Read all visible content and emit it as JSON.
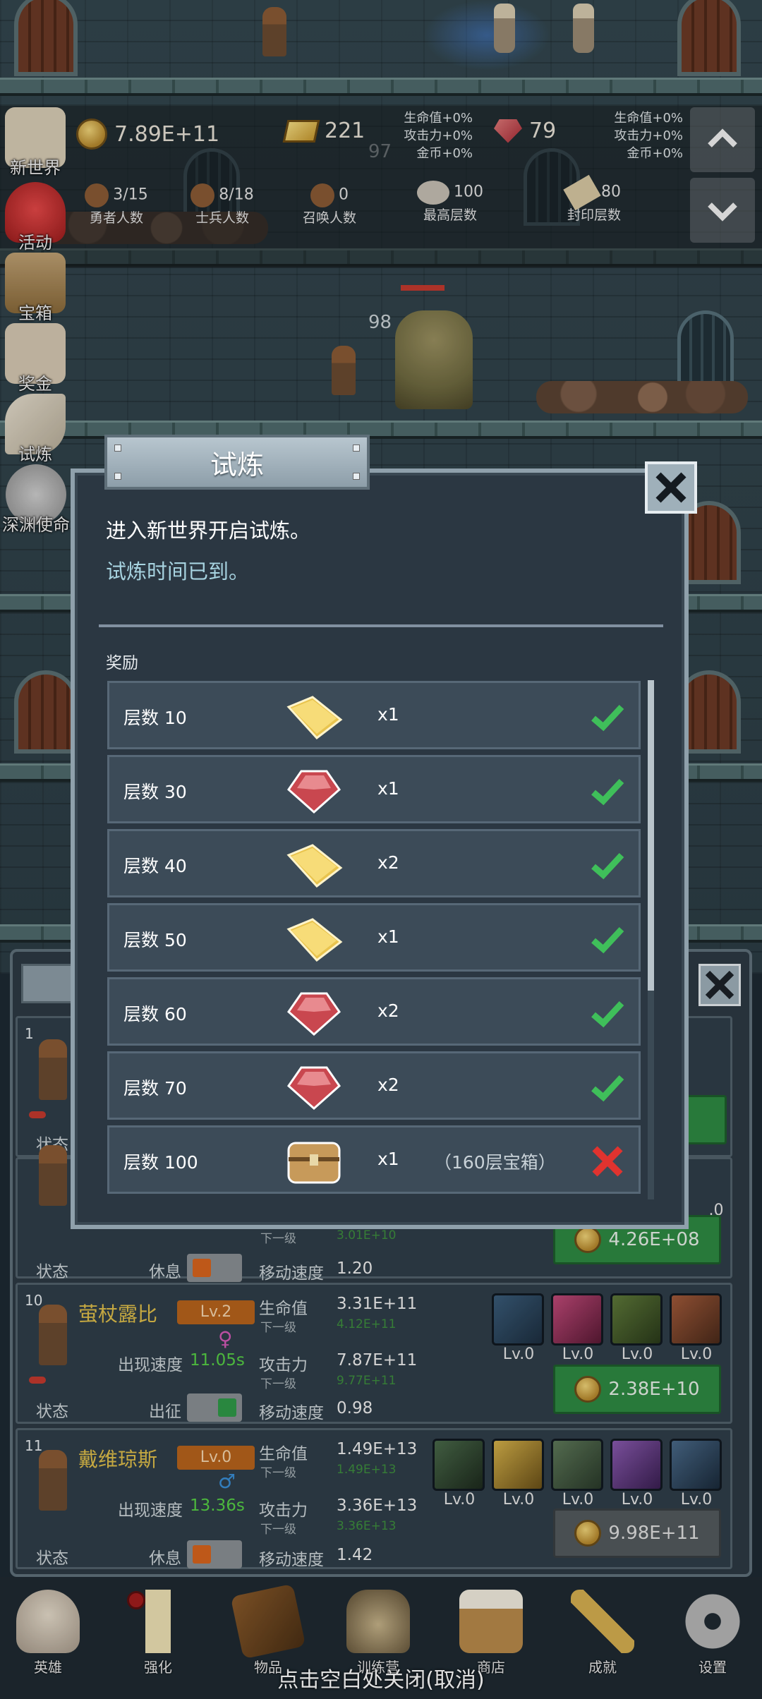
{
  "hud": {
    "gold": "7.89E+11",
    "goldbars": "221",
    "rubies": "79",
    "bonus_left": [
      "生命值+0%",
      "攻击力+0%",
      "金币+0%"
    ],
    "bonus_right": [
      "生命值+0%",
      "攻击力+0%",
      "金币+0%"
    ],
    "hero_count": "3/15",
    "hero_count_label": "勇者人数",
    "soldier_count": "8/18",
    "soldier_count_label": "士兵人数",
    "summon_count": "0",
    "summon_count_label": "召唤人数",
    "max_floor": "100",
    "max_floor_label": "最高层数",
    "sealed_floor": "80",
    "sealed_floor_label": "封印层数",
    "floor_97": "97",
    "floor_98": "98"
  },
  "side_menu": [
    {
      "label": "新世界",
      "icon": "new-world-icon"
    },
    {
      "label": "活动",
      "icon": "heart-icon"
    },
    {
      "label": "宝箱",
      "icon": "chest-icon"
    },
    {
      "label": "奖金",
      "icon": "envelope-icon"
    },
    {
      "label": "试炼",
      "icon": "feather-icon"
    },
    {
      "label": "深渊使命",
      "icon": "abyss-icon"
    }
  ],
  "modal": {
    "title": "试炼",
    "line1": "进入新世界开启试炼。",
    "line2": "试炼时间已到。",
    "rewards_label": "奖励",
    "rewards": [
      {
        "floor": "层数 10",
        "item": "goldbar-icon",
        "qty": "x1",
        "extra": "",
        "status": "claimed"
      },
      {
        "floor": "层数 30",
        "item": "ruby-icon",
        "qty": "x1",
        "extra": "",
        "status": "claimed"
      },
      {
        "floor": "层数 40",
        "item": "goldbar-icon",
        "qty": "x2",
        "extra": "",
        "status": "claimed"
      },
      {
        "floor": "层数 50",
        "item": "goldbar-icon",
        "qty": "x1",
        "extra": "",
        "status": "claimed"
      },
      {
        "floor": "层数 60",
        "item": "ruby-icon",
        "qty": "x2",
        "extra": "",
        "status": "claimed"
      },
      {
        "floor": "层数 70",
        "item": "ruby-icon",
        "qty": "x2",
        "extra": "",
        "status": "claimed"
      },
      {
        "floor": "层数 100",
        "item": "chest-icon",
        "qty": "x1",
        "extra": "（160层宝箱）",
        "status": "failed"
      }
    ]
  },
  "heroes": {
    "card1": {
      "index": "1",
      "status_label": "状态"
    },
    "card2": {
      "status_label": "状态",
      "state": "休息",
      "next_label": "下一级",
      "next_value": "3.01E+10",
      "speed_label": "移动速度",
      "speed": "1.20",
      "cost": "4.26E+08",
      "hidden_cost_tail": "8",
      "lv_tail": ".0"
    },
    "card3": {
      "index": "10",
      "name": "萤杖露比",
      "level": "Lv.2",
      "appear_label": "出现速度",
      "appear_value": "11.05s",
      "hp_label": "生命值",
      "hp": "3.31E+11",
      "hp_next_label": "下一级",
      "hp_next": "4.12E+11",
      "atk_label": "攻击力",
      "atk": "7.87E+11",
      "atk_next_label": "下一级",
      "atk_next": "9.77E+11",
      "speed_label": "移动速度",
      "speed": "0.98",
      "status_label": "状态",
      "state": "出征",
      "cost": "2.38E+10",
      "skills": [
        "Lv.0",
        "Lv.0",
        "Lv.0",
        "Lv.0"
      ]
    },
    "card4": {
      "index": "11",
      "name": "戴维琼斯",
      "level": "Lv.0",
      "appear_label": "出现速度",
      "appear_value": "13.36s",
      "hp_label": "生命值",
      "hp": "1.49E+13",
      "hp_next_label": "下一级",
      "hp_next": "1.49E+13",
      "atk_label": "攻击力",
      "atk": "3.36E+13",
      "atk_next_label": "下一级",
      "atk_next": "3.36E+13",
      "speed_label": "移动速度",
      "speed": "1.42",
      "status_label": "状态",
      "state": "休息",
      "cost": "9.98E+11",
      "skills": [
        "Lv.0",
        "Lv.0",
        "Lv.0",
        "Lv.0",
        "Lv.0"
      ]
    }
  },
  "bottom_nav": [
    {
      "label": "英雄",
      "icon": "skull-icon"
    },
    {
      "label": "强化",
      "icon": "candle-icon"
    },
    {
      "label": "物品",
      "icon": "book-icon"
    },
    {
      "label": "训练营",
      "icon": "lantern-icon"
    },
    {
      "label": "商店",
      "icon": "beer-mug-icon"
    },
    {
      "label": "成就",
      "icon": "key-icon"
    },
    {
      "label": "设置",
      "icon": "gear-icon"
    }
  ],
  "close_hint": "点击空白处关闭(取消)",
  "colors": {
    "claimed": "#3fbf5a",
    "failed": "#e0332f",
    "accent_gold": "#e1c04a",
    "button_green": "#2e8a43"
  }
}
